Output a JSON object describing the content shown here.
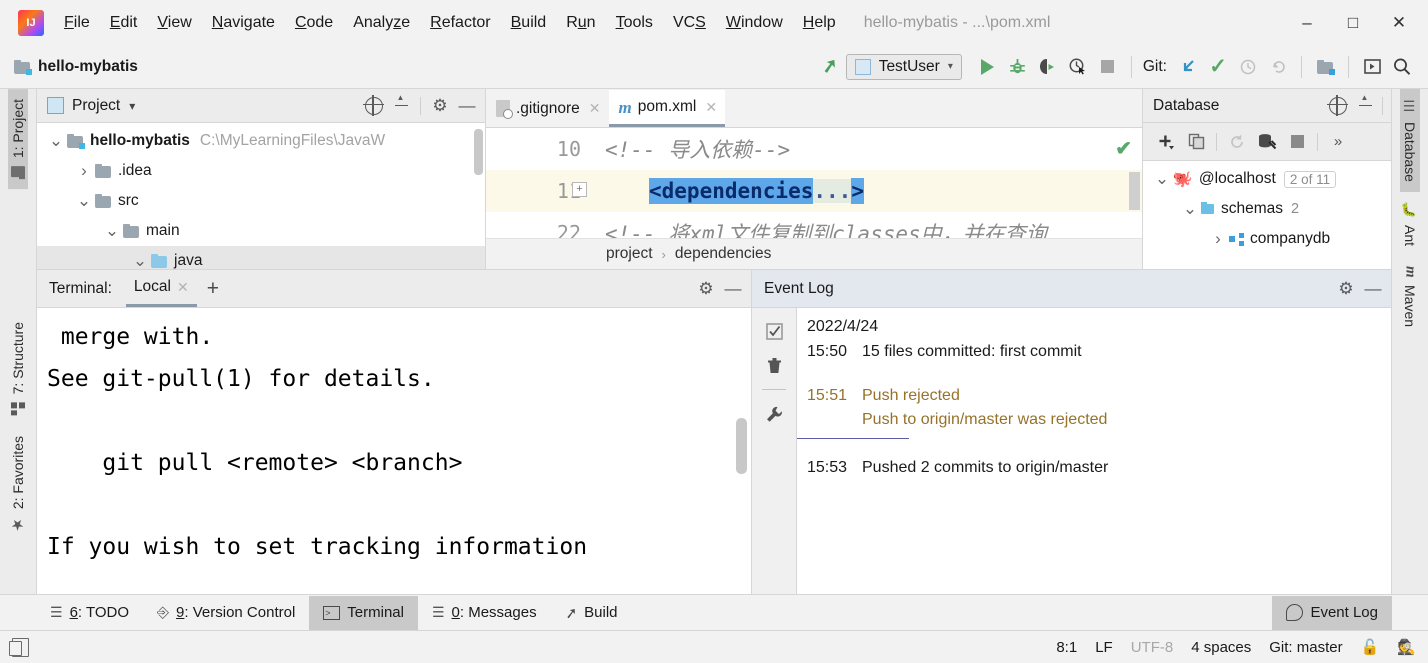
{
  "window": {
    "title": "hello-mybatis - ...\\pom.xml",
    "minimize_label": "–",
    "maximize_label": "□",
    "close_label": "✕"
  },
  "menubar": {
    "items": [
      {
        "label": "File",
        "mnemonic": "F"
      },
      {
        "label": "Edit",
        "mnemonic": "E"
      },
      {
        "label": "View",
        "mnemonic": "V"
      },
      {
        "label": "Navigate",
        "mnemonic": "N"
      },
      {
        "label": "Code",
        "mnemonic": "C"
      },
      {
        "label": "Analyze",
        "mnemonic": "z"
      },
      {
        "label": "Refactor",
        "mnemonic": "R"
      },
      {
        "label": "Build",
        "mnemonic": "B"
      },
      {
        "label": "Run",
        "mnemonic": "u"
      },
      {
        "label": "Tools",
        "mnemonic": "T"
      },
      {
        "label": "VCS",
        "mnemonic": "S"
      },
      {
        "label": "Window",
        "mnemonic": "W"
      },
      {
        "label": "Help",
        "mnemonic": "H"
      }
    ]
  },
  "navbar": {
    "project_name": "hello-mybatis",
    "run_config": "TestUser",
    "git_label": "Git:",
    "icons": {
      "build": "hammer-icon",
      "run": "run-icon",
      "debug": "debug-icon",
      "run_coverage": "run-with-coverage-icon",
      "profile": "profiler-icon",
      "stop": "stop-icon",
      "update_project": "git-update-icon",
      "commit": "git-commit-icon",
      "history": "git-history-icon",
      "rollback": "git-rollback-icon",
      "project_structure": "project-structure-icon",
      "select_in": "select-in-icon",
      "search": "search-everywhere-icon"
    }
  },
  "left_stripe": {
    "items": [
      {
        "label": "1: Project",
        "mnemonic": "1",
        "icon": "folder-icon",
        "active": true
      },
      {
        "label": "7: Structure",
        "mnemonic": "7",
        "icon": "structure-icon",
        "active": false
      },
      {
        "label": "2: Favorites",
        "mnemonic": "2",
        "icon": "star-icon",
        "active": false
      }
    ]
  },
  "right_stripe": {
    "items": [
      {
        "label": "Database",
        "icon": "database-icon",
        "active": true
      },
      {
        "label": "Ant",
        "icon": "ant-icon",
        "active": false
      },
      {
        "label": "Maven",
        "icon": "maven-icon",
        "active": false
      }
    ]
  },
  "project_panel": {
    "title": "Project",
    "dropdown": "▾",
    "tree": [
      {
        "label": "hello-mybatis",
        "path": "C:\\MyLearningFiles\\JavaW",
        "indent": 0,
        "state": "open",
        "bold": true,
        "icon": "module-folder-icon",
        "selected": false
      },
      {
        "label": ".idea",
        "path": "",
        "indent": 1,
        "state": "closed",
        "bold": false,
        "icon": "folder-icon",
        "selected": false
      },
      {
        "label": "src",
        "path": "",
        "indent": 1,
        "state": "open",
        "bold": false,
        "icon": "folder-icon",
        "selected": false
      },
      {
        "label": "main",
        "path": "",
        "indent": 2,
        "state": "open",
        "bold": false,
        "icon": "folder-icon",
        "selected": false
      },
      {
        "label": "java",
        "path": "",
        "indent": 3,
        "state": "open",
        "bold": false,
        "icon": "source-folder-icon",
        "selected": true
      }
    ]
  },
  "editor": {
    "tabs": [
      {
        "label": ".gitignore",
        "icon": "gitignore-file-icon",
        "active": false,
        "close": "✕"
      },
      {
        "label": "pom.xml",
        "icon": "maven-file-icon",
        "active": true,
        "close": "✕"
      }
    ],
    "lines": [
      {
        "number": "10",
        "text": "<!--      导入依赖-->",
        "kind": "comment",
        "highlight": false
      },
      {
        "number": "11",
        "text": "<dependencies...>",
        "kind": "folded-tag",
        "highlight": true
      },
      {
        "number": "22",
        "text": "<!--     将xml文件复制到classes中，并在查询",
        "kind": "comment",
        "highlight": false
      }
    ],
    "line11_selected_text": "<dependencies",
    "line11_folded_text": "...",
    "line11_tail": ">",
    "breadcrumb": [
      "project",
      "dependencies"
    ],
    "breadcrumb_sep": "›",
    "inspection_status": "✔"
  },
  "database_panel": {
    "title": "Database",
    "toolbar_icons": [
      "add-icon",
      "duplicate-icon",
      "refresh-icon",
      "run-query-icon",
      "stop-icon",
      "more-icon"
    ],
    "more_label": "»",
    "tree": [
      {
        "label": "@localhost",
        "badge": "2 of 11",
        "count": "",
        "indent": 0,
        "state": "open",
        "icon": "mysql-icon"
      },
      {
        "label": "schemas",
        "badge": "",
        "count": "2",
        "indent": 1,
        "state": "open",
        "icon": "schema-folder-icon"
      },
      {
        "label": "companydb",
        "badge": "",
        "count": "",
        "indent": 2,
        "state": "closed",
        "icon": "database-schema-icon"
      }
    ]
  },
  "terminal_panel": {
    "label": "Terminal:",
    "tabs": [
      {
        "label": "Local",
        "active": true,
        "close": "✕"
      }
    ],
    "add_label": "+",
    "lines": [
      " merge with.",
      "See git-pull(1) for details.",
      "",
      "    git pull <remote> <branch>",
      "",
      "If you wish to set tracking information"
    ]
  },
  "event_log": {
    "title": "Event Log",
    "rail_icons": [
      "mark-all-read-icon",
      "delete-icon",
      "settings-wrench-icon"
    ],
    "date": "2022/4/24",
    "entries": [
      {
        "time": "15:50",
        "message": "15 files committed: first commit",
        "level": "info",
        "sub": ""
      },
      {
        "time": "15:51",
        "message": "Push rejected",
        "level": "warn",
        "sub": "Push to origin/master was rejected"
      },
      {
        "time": "15:53",
        "message": "Pushed 2 commits to origin/master",
        "level": "info",
        "sub": ""
      }
    ]
  },
  "tool_tabs": {
    "items": [
      {
        "label": "6: TODO",
        "mnemonic": "6",
        "icon": "todo-icon",
        "active": false
      },
      {
        "label": "9: Version Control",
        "mnemonic": "9",
        "icon": "version-control-icon",
        "active": false
      },
      {
        "label": "Terminal",
        "mnemonic": "",
        "icon": "terminal-icon",
        "active": true
      },
      {
        "label": "0: Messages",
        "mnemonic": "0",
        "icon": "messages-icon",
        "active": false
      },
      {
        "label": "Build",
        "mnemonic": "",
        "icon": "build-hammer-icon",
        "active": false
      }
    ],
    "right_item": {
      "label": "Event Log",
      "icon": "event-log-bell-icon",
      "active": true
    }
  },
  "statusbar": {
    "left_icon": "toggle-sidebars-icon",
    "caret": "8:1",
    "line_separator": "LF",
    "encoding": "UTF-8",
    "indent": "4 spaces",
    "branch": "Git: master",
    "lock_icon": "unlocked-icon",
    "inspector_icon": "hector-inspector-icon"
  }
}
